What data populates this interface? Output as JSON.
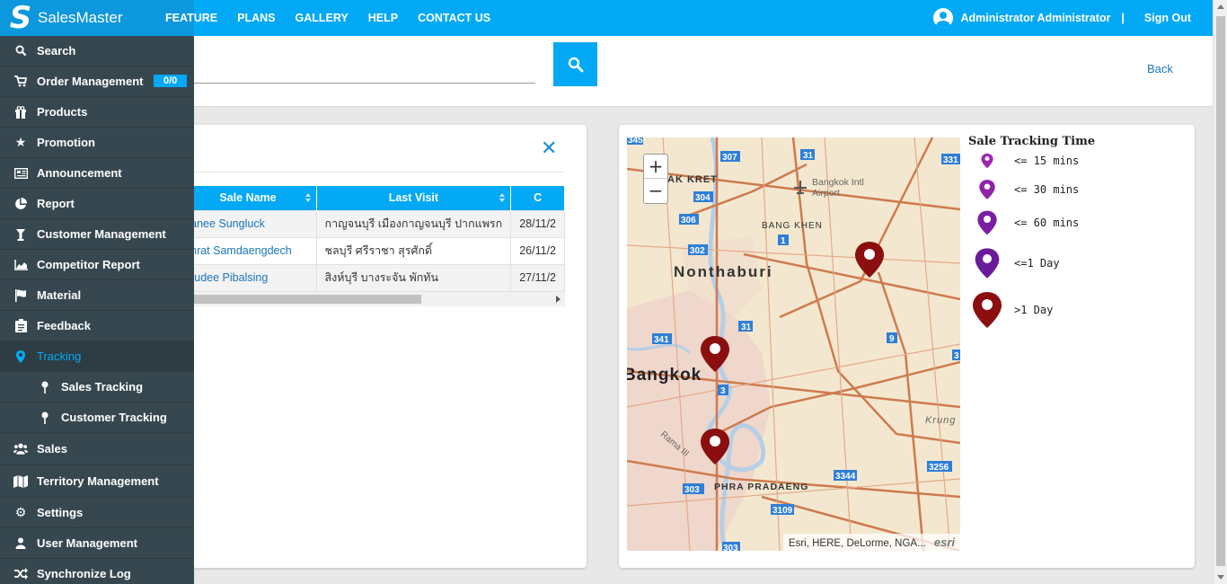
{
  "app": {
    "brand_letter": "S",
    "brand_name": "SalesMaster"
  },
  "topnav": {
    "items": [
      "FEATURE",
      "PLANS",
      "GALLERY",
      "HELP",
      "CONTACT US"
    ],
    "user_name": "Administrator Administrator",
    "separator": "|",
    "sign_out": "Sign Out"
  },
  "sidebar": {
    "items": [
      {
        "label": "Search",
        "icon": "search-icon"
      },
      {
        "label": "Order Management",
        "icon": "cart-icon",
        "badge": "0/0"
      },
      {
        "label": "Products",
        "icon": "gift-icon"
      },
      {
        "label": "Promotion",
        "icon": "star-icon"
      },
      {
        "label": "Announcement",
        "icon": "newspaper-icon"
      },
      {
        "label": "Report",
        "icon": "pie-chart-icon"
      },
      {
        "label": "Customer Management",
        "icon": "customer-icon"
      },
      {
        "label": "Competitor Report",
        "icon": "area-chart-icon"
      },
      {
        "label": "Material",
        "icon": "flag-icon"
      },
      {
        "label": "Feedback",
        "icon": "clipboard-icon"
      },
      {
        "label": "Tracking",
        "icon": "map-pin-icon",
        "active": true
      },
      {
        "label": "Sales Tracking",
        "icon": "pin-icon",
        "sub": true
      },
      {
        "label": "Customer Tracking",
        "icon": "pin-icon",
        "sub": true
      },
      {
        "label": "Sales",
        "icon": "users-icon"
      },
      {
        "label": "Territory Management",
        "icon": "map-icon"
      },
      {
        "label": "Settings",
        "icon": "gear-icon"
      },
      {
        "label": "User Management",
        "icon": "user-icon"
      },
      {
        "label": "Synchronize Log",
        "icon": "shuffle-icon"
      }
    ]
  },
  "search": {
    "back_label": "Back"
  },
  "table": {
    "headers": [
      "Sale Name",
      "Last Visit",
      "C"
    ],
    "rows": [
      {
        "name": "pranee Sungluck",
        "last_visit": "กาญจนบุรี เมืองกาญจนบุรี ปากแพรก",
        "c": "28/11/2"
      },
      {
        "name": "ranrat Samdaengdech",
        "last_visit": "ชลบุรี ศรีราชา สุรศักดิ์",
        "c": "26/11/2"
      },
      {
        "name": "rnrudee Pibalsing",
        "last_visit": "สิงห์บุรี บางระจัน พักทัน",
        "c": "27/11/2"
      }
    ]
  },
  "map": {
    "labels": {
      "nonthaburi": "Nonthaburi",
      "bangkok": "Bangkok",
      "airport": "Bangkok Intl Airport",
      "bang_khen": "BANG KHEN",
      "ak_kret": "AK KRET",
      "phra_pradaeng": "PHRA PRADAENG",
      "rama": "Rama III",
      "krung": "Krung"
    },
    "road_shields": [
      "345",
      "307",
      "31",
      "331",
      "304",
      "306",
      "1",
      "302",
      "31",
      "9",
      "341",
      "3",
      "3344",
      "3256",
      "303",
      "3109",
      "303",
      "3"
    ],
    "zoom_in": "+",
    "zoom_out": "−",
    "attribution": "Esri, HERE, DeLorme, NGA...",
    "esri_logo": "esri"
  },
  "legend": {
    "title": "Sale Tracking Time",
    "items": [
      {
        "label": "<= 15 mins",
        "color": "#9c27b0"
      },
      {
        "label": "<= 30 mins",
        "color": "#8e24aa"
      },
      {
        "label": "<= 60 mins",
        "color": "#7b1fa2"
      },
      {
        "label": "<=1 Day",
        "color": "#6a1b9a"
      },
      {
        "label": ">1 Day",
        "color": "#8b0f0f"
      }
    ]
  },
  "colors": {
    "accent": "#03a9f4",
    "sidebar": "#37474f",
    "link": "#1b75bb"
  }
}
